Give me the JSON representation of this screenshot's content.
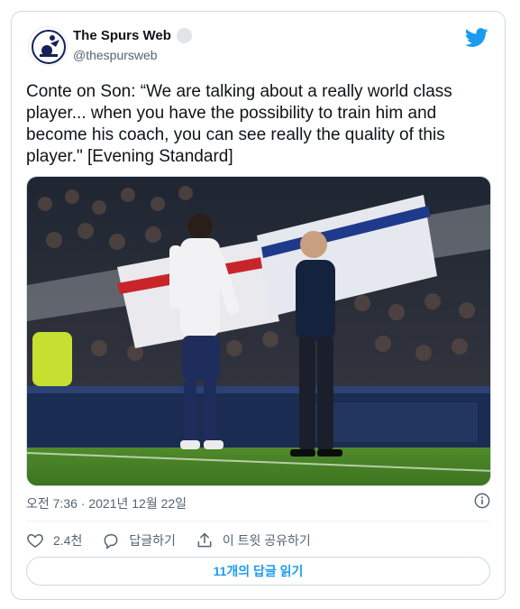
{
  "author": {
    "display_name": "The Spurs Web",
    "handle": "@thespursweb",
    "avatar_icon": "spurs-crest-icon"
  },
  "platform_icon": "twitter-bird-icon",
  "colors": {
    "brand": "#1d9bf0",
    "text_primary": "#0f1419",
    "text_secondary": "#536471",
    "border": "#cfd9de"
  },
  "tweet": {
    "text": "Conte on Son: “We are talking about a really world class player... when you have the possibility to train him and become his coach, you can see really the quality of this player.\" [Evening Standard]",
    "photo": {
      "alt_icon": "football-photo"
    },
    "timestamp": "오전 7:36 · 2021년 12월 22일"
  },
  "actions": {
    "like": {
      "icon": "heart-icon",
      "label": "2.4천"
    },
    "reply": {
      "icon": "reply-bubble-icon",
      "label": "답글하기"
    },
    "share": {
      "icon": "share-icon",
      "label": "이 트윗 공유하기"
    }
  },
  "read_replies_label": "11개의 답글 읽기",
  "info_icon": "info-icon"
}
